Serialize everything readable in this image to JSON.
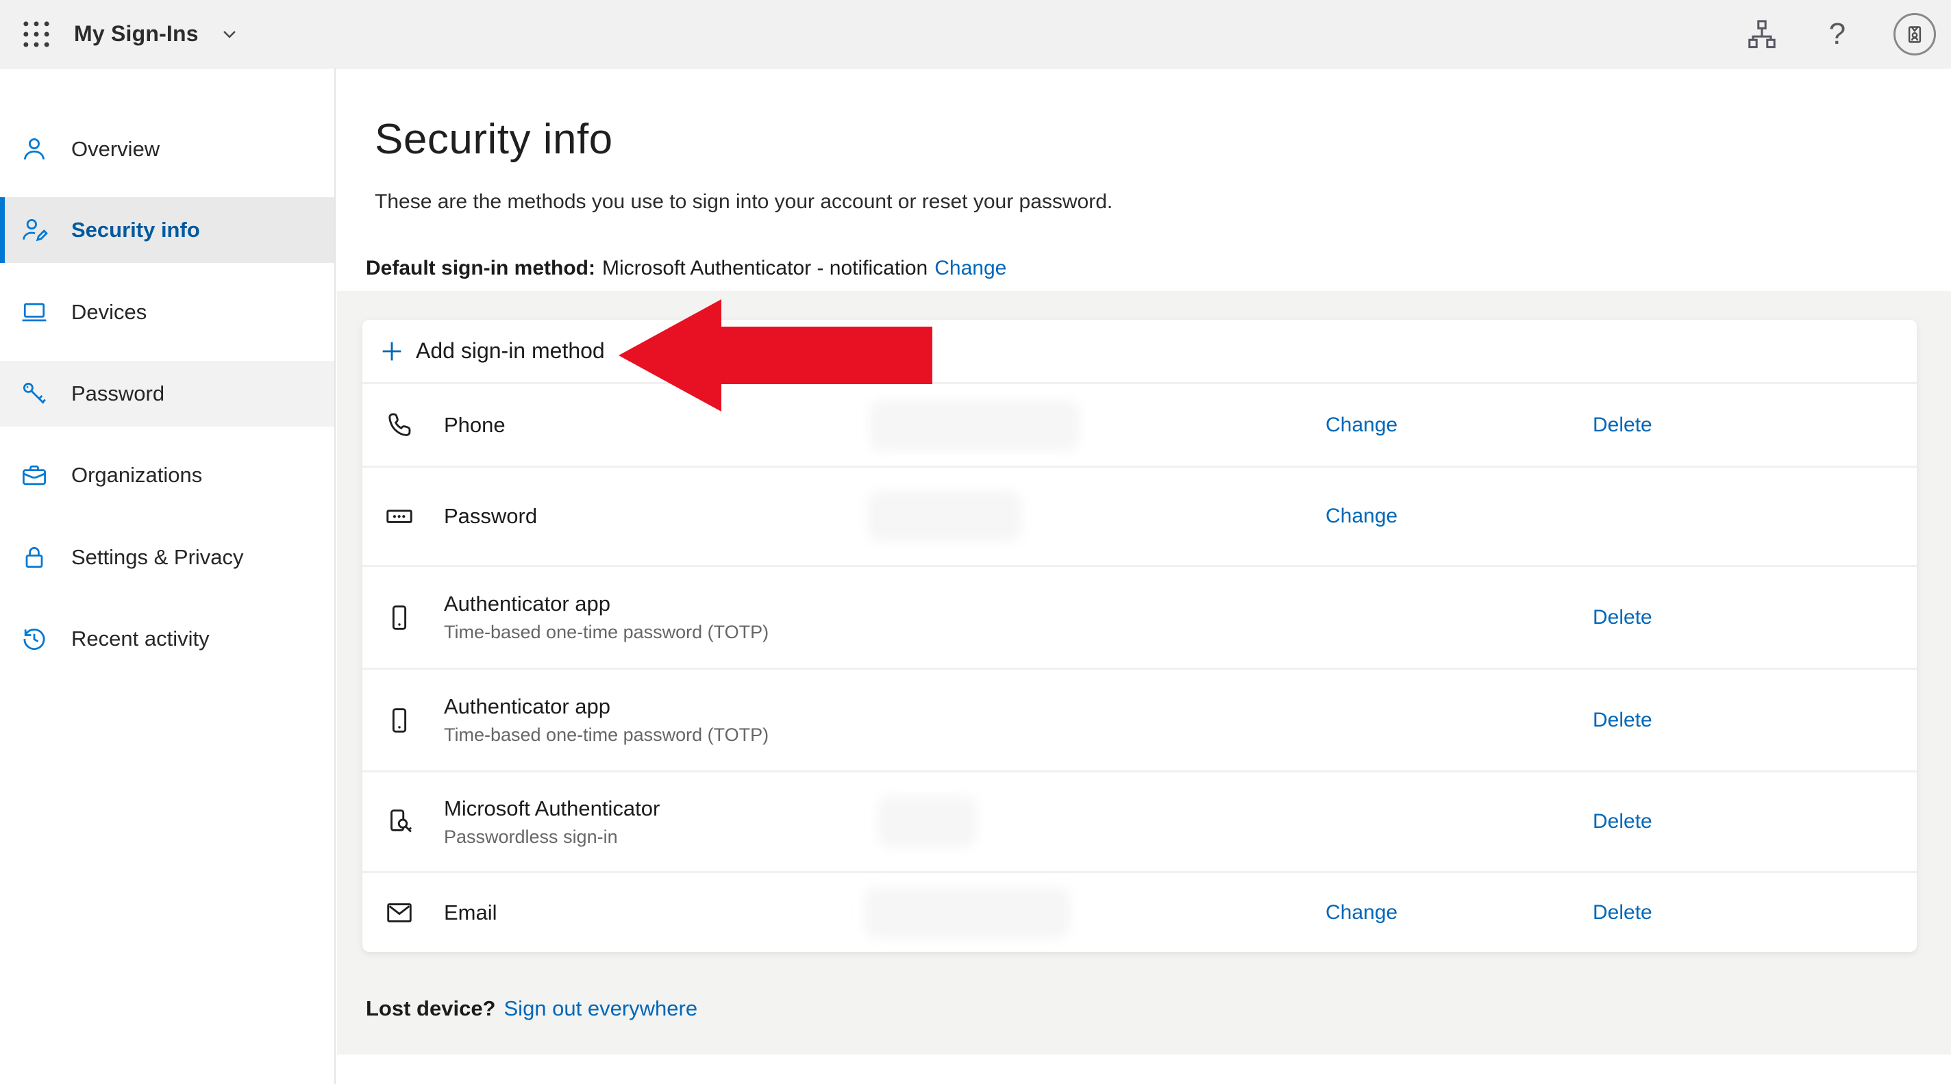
{
  "header": {
    "app_title": "My Sign-Ins",
    "help_glyph": "?",
    "icons": [
      "app-launcher-waffle",
      "chevron-down",
      "org-chart",
      "help",
      "avatar-id-badge"
    ]
  },
  "sidebar": {
    "items": [
      {
        "label": "Overview",
        "icon": "person",
        "active": false
      },
      {
        "label": "Security info",
        "icon": "person-edit",
        "active": true
      },
      {
        "label": "Devices",
        "icon": "laptop",
        "active": false
      },
      {
        "label": "Password",
        "icon": "key",
        "active": false,
        "hovered": true
      },
      {
        "label": "Organizations",
        "icon": "briefcase",
        "active": false
      },
      {
        "label": "Settings & Privacy",
        "icon": "lock",
        "active": false
      },
      {
        "label": "Recent activity",
        "icon": "history-clock",
        "active": false
      }
    ]
  },
  "main": {
    "title": "Security info",
    "description": "These are the methods you use to sign into your account or reset your password.",
    "default_method": {
      "label": "Default sign-in method:",
      "value": "Microsoft Authenticator - notification",
      "change_label": "Change"
    },
    "add_button": {
      "label": "Add sign-in method",
      "icon": "plus"
    },
    "methods": [
      {
        "icon": "phone-handset",
        "title": "Phone",
        "subtitle": "",
        "change_label": "Change",
        "delete_label": "Delete",
        "value_redacted": true
      },
      {
        "icon": "password-box",
        "title": "Password",
        "subtitle": "",
        "change_label": "Change",
        "value_redacted": true
      },
      {
        "icon": "smartphone",
        "title": "Authenticator app",
        "subtitle": "Time-based one-time password (TOTP)",
        "delete_label": "Delete",
        "value_redacted": false
      },
      {
        "icon": "smartphone",
        "title": "Authenticator app",
        "subtitle": "Time-based one-time password (TOTP)",
        "delete_label": "Delete",
        "value_redacted": false
      },
      {
        "icon": "phone-key",
        "title": "Microsoft Authenticator",
        "subtitle": "Passwordless sign-in",
        "delete_label": "Delete",
        "value_redacted": true
      },
      {
        "icon": "envelope",
        "title": "Email",
        "subtitle": "",
        "change_label": "Change",
        "delete_label": "Delete",
        "value_redacted": true
      }
    ],
    "lost_device": {
      "label": "Lost device?",
      "link_label": "Sign out everywhere"
    },
    "annotation": {
      "type": "red-arrow-pointing-left-at-add-sign-in-method"
    }
  },
  "colors": {
    "header_bg": "#f1f1f1",
    "page_band_bg": "#f3f3f2",
    "accent_blue": "#0078d4",
    "link_blue": "#0067b8",
    "active_nav_text": "#005a9e",
    "arrow_red": "#e81123"
  }
}
